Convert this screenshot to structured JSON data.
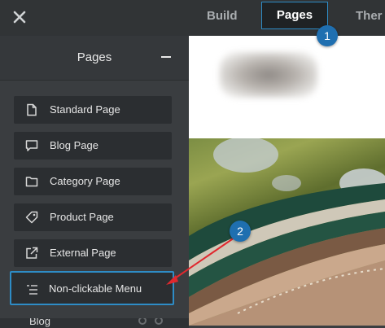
{
  "topbar": {
    "tabs": [
      {
        "label": "Build"
      },
      {
        "label": "Pages"
      },
      {
        "label": "Ther"
      }
    ],
    "active_tab": "Pages",
    "close_icon": "close-icon"
  },
  "panel": {
    "title": "Pages",
    "collapse_icon": "minus-icon",
    "buttons": [
      {
        "label": "Standard Page",
        "icon": "document-icon"
      },
      {
        "label": "Blog Page",
        "icon": "speech-bubble-icon"
      },
      {
        "label": "Category Page",
        "icon": "folder-icon"
      },
      {
        "label": "Product Page",
        "icon": "tag-icon"
      },
      {
        "label": "External Page",
        "icon": "external-link-icon"
      },
      {
        "label": "Non-clickable Menu",
        "icon": "menu-list-icon"
      }
    ],
    "partial_item": {
      "label": "Blog"
    }
  },
  "callouts": [
    {
      "number": "1"
    },
    {
      "number": "2"
    }
  ],
  "colors": {
    "accent": "#2e8cc6",
    "badge": "#1f6fb0",
    "arrow": "#e0282e",
    "panel_bg": "#3a3d40",
    "button_bg": "#2b2e31"
  }
}
